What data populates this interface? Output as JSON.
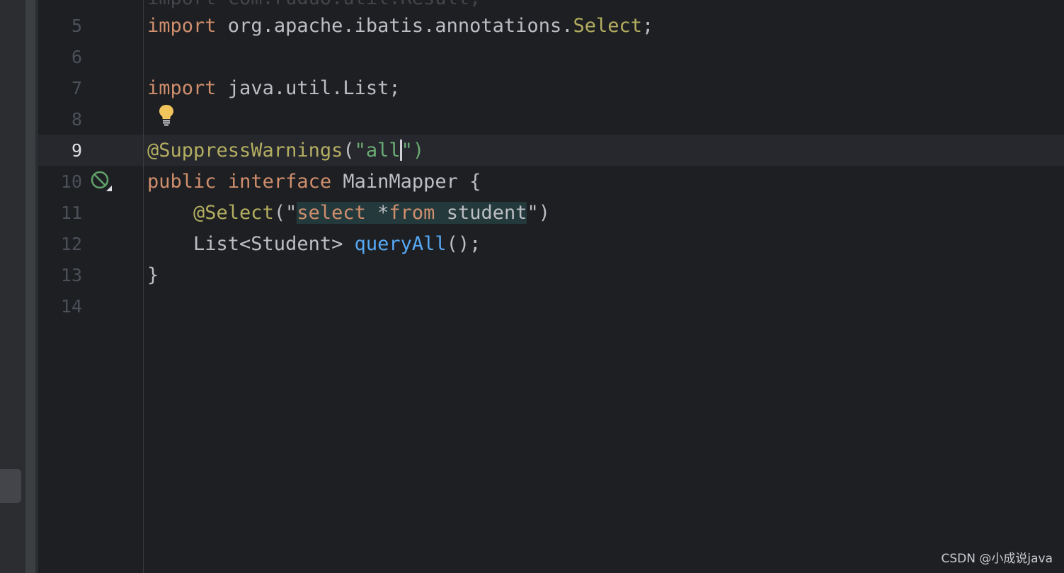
{
  "editor": {
    "current_line": "9",
    "lines": [
      {
        "number": "5",
        "tokens": [
          "import",
          " org.apache.ibatis.annotations.",
          "Select",
          ";"
        ]
      },
      {
        "number": "6",
        "tokens": []
      },
      {
        "number": "7",
        "tokens": [
          "import",
          " java.util.List;"
        ]
      },
      {
        "number": "8",
        "tokens": []
      },
      {
        "number": "9",
        "tokens": [
          "@SuppressWarnings",
          "(",
          "\"all",
          "\")"
        ]
      },
      {
        "number": "10",
        "tokens": [
          "public",
          " ",
          "interface",
          " MainMapper {"
        ]
      },
      {
        "number": "11",
        "tokens": [
          "    ",
          "@Select",
          "(\"",
          "select ",
          "*",
          "from",
          " student",
          "\")"
        ]
      },
      {
        "number": "12",
        "tokens": [
          "    List<Student> ",
          "queryAll",
          "();"
        ]
      },
      {
        "number": "13",
        "tokens": [
          "}"
        ]
      },
      {
        "number": "14",
        "tokens": []
      }
    ]
  },
  "icons": {
    "intention": "lightbulb-icon",
    "gutter": "disabled-run-icon"
  },
  "watermark": "CSDN @小成说java",
  "colors": {
    "background": "#1e1f22",
    "keyword": "#cf8e6d",
    "annotation": "#b3ae60",
    "string": "#6aab73",
    "method": "#56a8f5",
    "text": "#bcbec4"
  }
}
